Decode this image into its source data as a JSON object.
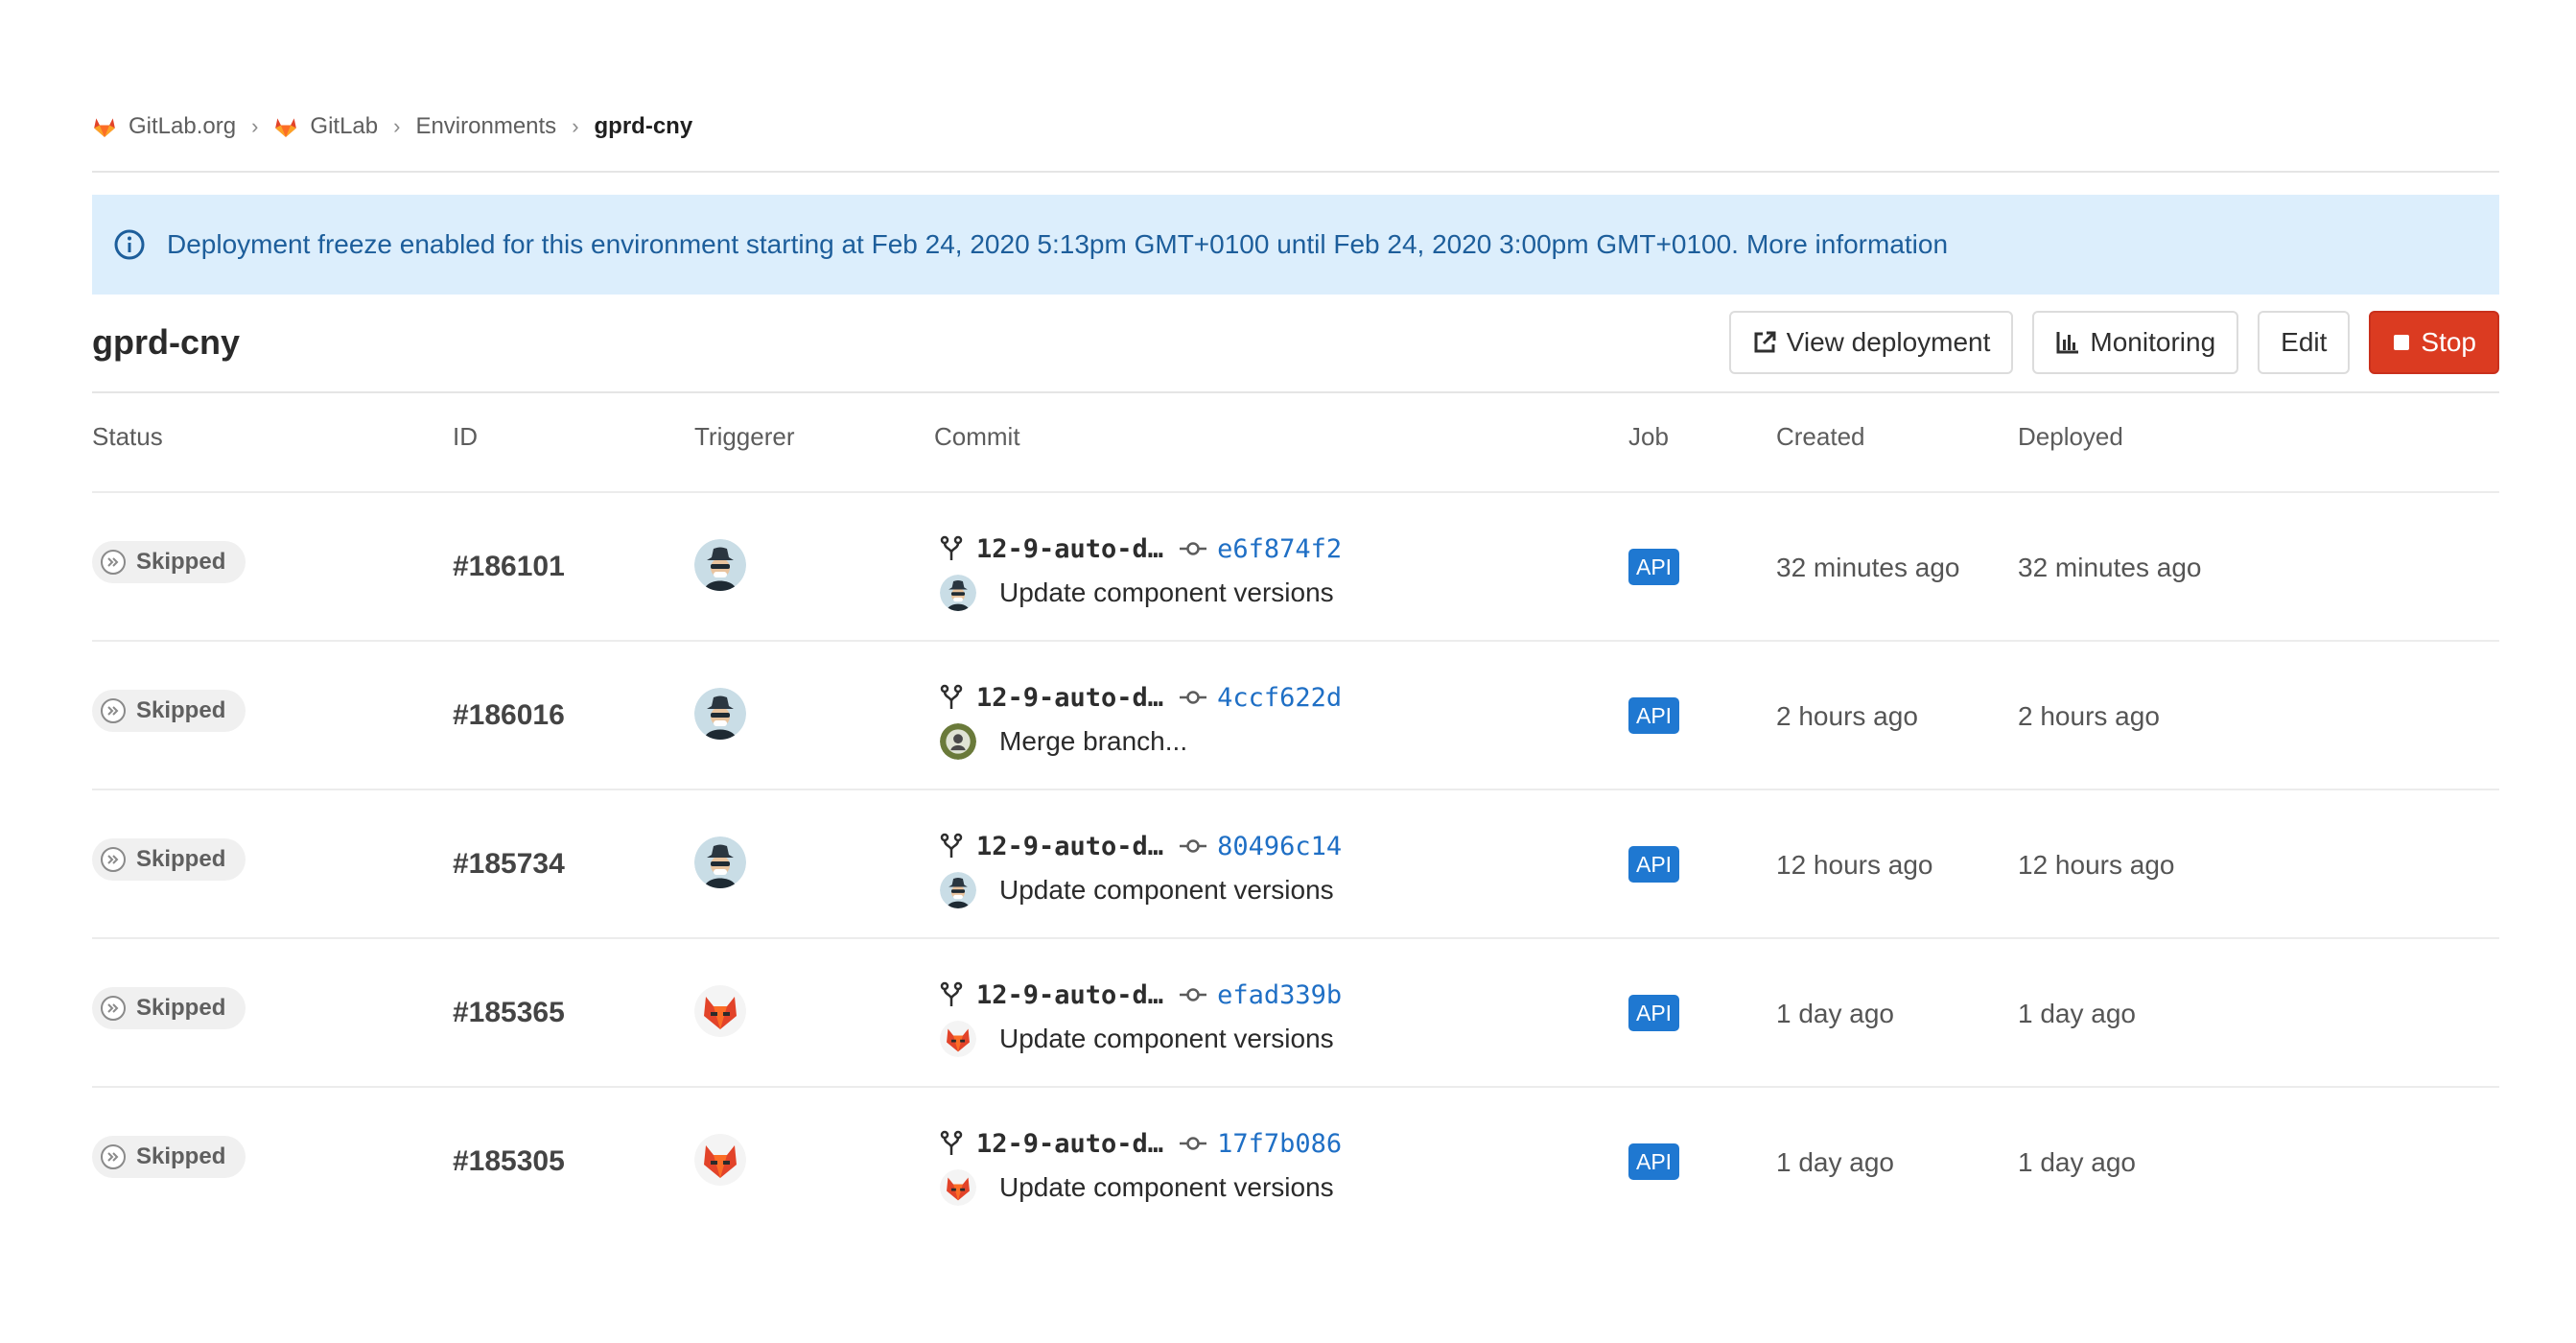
{
  "breadcrumb": [
    {
      "label": "GitLab.org",
      "icon": "gitlab-logo-icon"
    },
    {
      "label": "GitLab",
      "icon": "gitlab-logo-icon"
    },
    {
      "label": "Environments"
    },
    {
      "label": "gprd-cny"
    }
  ],
  "alert": {
    "icon": "info-icon",
    "text": "Deployment freeze enabled for this environment starting at Feb 24, 2020 5:13pm GMT+0100 until Feb 24, 2020 3:00pm GMT+0100.",
    "link": "More information"
  },
  "environment": {
    "title": "gprd-cny"
  },
  "actions": {
    "view_deployment": "View deployment",
    "monitoring": "Monitoring",
    "edit": "Edit",
    "stop": "Stop"
  },
  "table": {
    "headers": {
      "status": "Status",
      "id": "ID",
      "triggerer": "Triggerer",
      "commit": "Commit",
      "job": "Job",
      "created": "Created",
      "deployed": "Deployed"
    },
    "rows": [
      {
        "status": "Skipped",
        "id": "#186101",
        "triggerer": "spy-avatar",
        "branch": "12-9-auto-d…",
        "sha": "e6f874f2",
        "commit_avatar": "spy-avatar",
        "message": "Update component versions",
        "job": "API",
        "created": "32 minutes ago",
        "deployed": "32 minutes ago"
      },
      {
        "status": "Skipped",
        "id": "#186016",
        "triggerer": "spy-avatar",
        "branch": "12-9-auto-d…",
        "sha": "4ccf622d",
        "commit_avatar": "green-avatar",
        "message": "Merge branch...",
        "job": "API",
        "created": "2 hours ago",
        "deployed": "2 hours ago"
      },
      {
        "status": "Skipped",
        "id": "#185734",
        "triggerer": "spy-avatar",
        "branch": "12-9-auto-d…",
        "sha": "80496c14",
        "commit_avatar": "spy-avatar",
        "message": "Update component versions",
        "job": "API",
        "created": "12 hours ago",
        "deployed": "12 hours ago"
      },
      {
        "status": "Skipped",
        "id": "#185365",
        "triggerer": "fox-avatar",
        "branch": "12-9-auto-d…",
        "sha": "efad339b",
        "commit_avatar": "fox-avatar",
        "message": "Update component versions",
        "job": "API",
        "created": "1 day ago",
        "deployed": "1 day ago"
      },
      {
        "status": "Skipped",
        "id": "#185305",
        "triggerer": "fox-avatar",
        "branch": "12-9-auto-d…",
        "sha": "17f7b086",
        "commit_avatar": "fox-avatar",
        "message": "Update component versions",
        "job": "API",
        "created": "1 day ago",
        "deployed": "1 day ago"
      }
    ]
  },
  "colors": {
    "accent": "#1f78d1",
    "danger": "#db3b21",
    "alert_bg": "#dceefc",
    "alert_text": "#1d5e9b"
  }
}
